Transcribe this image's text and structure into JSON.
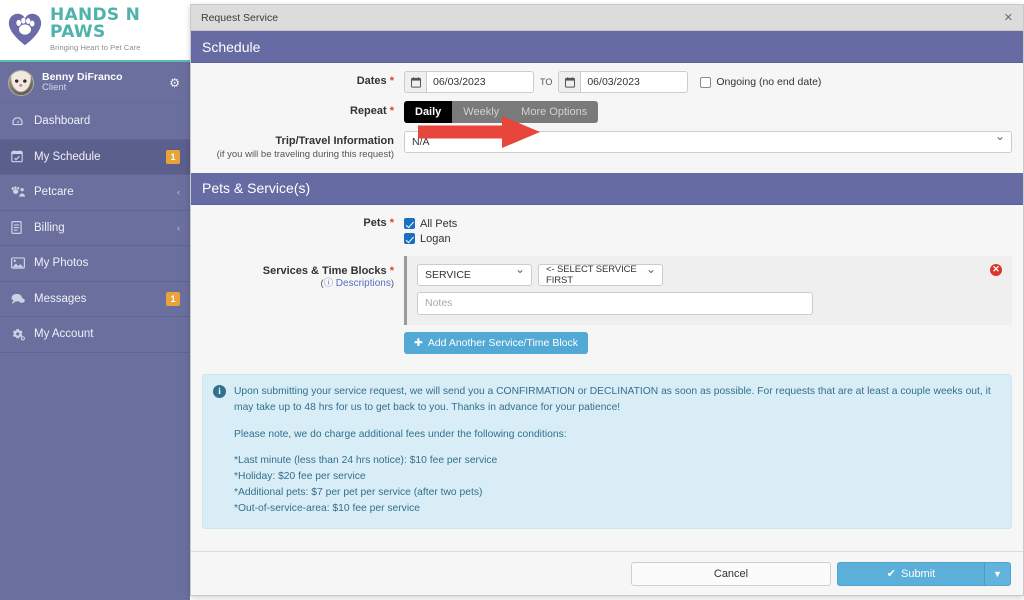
{
  "brand": {
    "logo_title": "HANDS N PAWS",
    "logo_tagline": "Bringing Heart to Pet Care",
    "accent_teal": "#4fb3ab",
    "accent_purple": "#6a6f9e",
    "header_purple": "#666ca3",
    "badge_orange": "#e8a33d",
    "submit_blue": "#5bafd9",
    "danger_red": "#d9352c",
    "annotation_red": "#e8453c"
  },
  "sidebar": {
    "user": {
      "name": "Benny DiFranco",
      "role": "Client",
      "gear_icon": "gear-icon",
      "avatar_icon": "avatar"
    },
    "items": [
      {
        "label": "Dashboard",
        "icon": "dashboard-icon",
        "badge": "",
        "caret": "",
        "active": false
      },
      {
        "label": "My Schedule",
        "icon": "calendar-icon",
        "badge": "1",
        "caret": "",
        "active": true
      },
      {
        "label": "Petcare",
        "icon": "paw-users-icon",
        "badge": "",
        "caret": "‹",
        "active": false
      },
      {
        "label": "Billing",
        "icon": "document-icon",
        "badge": "",
        "caret": "‹",
        "active": false
      },
      {
        "label": "My Photos",
        "icon": "image-icon",
        "badge": "",
        "caret": "",
        "active": false
      },
      {
        "label": "Messages",
        "icon": "chat-icon",
        "badge": "1",
        "caret": "",
        "active": false
      },
      {
        "label": "My Account",
        "icon": "cogs-icon",
        "badge": "",
        "caret": "",
        "active": false
      }
    ]
  },
  "modal": {
    "title": "Request Service",
    "close_icon": "close-icon"
  },
  "schedule": {
    "heading": "Schedule",
    "dates": {
      "label": "Dates",
      "required": "*",
      "start_value": "06/03/2023",
      "end_value": "06/03/2023",
      "separator": "TO",
      "calendar_icon": "calendar-icon",
      "ongoing_label": "Ongoing (no end date)",
      "ongoing_checked": false
    },
    "repeat": {
      "label": "Repeat",
      "required": "*",
      "options": [
        "Daily",
        "Weekly",
        "More Options"
      ],
      "selected": "Daily"
    },
    "trip": {
      "label": "Trip/Travel Information",
      "sub_label": "(if you will be traveling during this request)",
      "value": "N/A"
    }
  },
  "pets_services": {
    "heading": "Pets & Service(s)",
    "pets": {
      "label": "Pets",
      "required": "*",
      "options": [
        {
          "label": "All Pets",
          "checked": true
        },
        {
          "label": "Logan",
          "checked": true
        }
      ]
    },
    "services": {
      "label": "Services & Time Blocks",
      "required": "*",
      "descriptions_link": "Descriptions",
      "help_icon": "question-circle-icon",
      "service_select_value": "SERVICE",
      "block_select_value": "<- SELECT SERVICE FIRST",
      "notes_placeholder": "Notes",
      "notes_value": "",
      "remove_icon": "remove-circle-icon",
      "add_button": "Add Another Service/Time Block",
      "add_icon": "plus-circle-icon"
    }
  },
  "alert": {
    "icon": "info-icon",
    "paragraph1": "Upon submitting your service request, we will send you a CONFIRMATION or DECLINATION as soon as possible. For requests that are at least a couple weeks out, it may take up to 48 hrs for us to get back to you. Thanks in advance for your patience!",
    "paragraph2": "Please note, we do charge additional fees under the following conditions:",
    "fees": [
      "*Last minute (less than 24 hrs notice): $10 fee per service",
      "*Holiday: $20 fee per service",
      "*Additional pets: $7 per pet per service (after two pets)",
      "*Out-of-service-area: $10 fee per service"
    ]
  },
  "footer": {
    "cancel_label": "Cancel",
    "submit_label": "Submit",
    "submit_icon": "check-circle-icon",
    "submit_caret_icon": "caret-down-icon"
  },
  "annotation": {
    "arrow": "red-arrow-pointing-right",
    "points_to": "Repeat"
  }
}
